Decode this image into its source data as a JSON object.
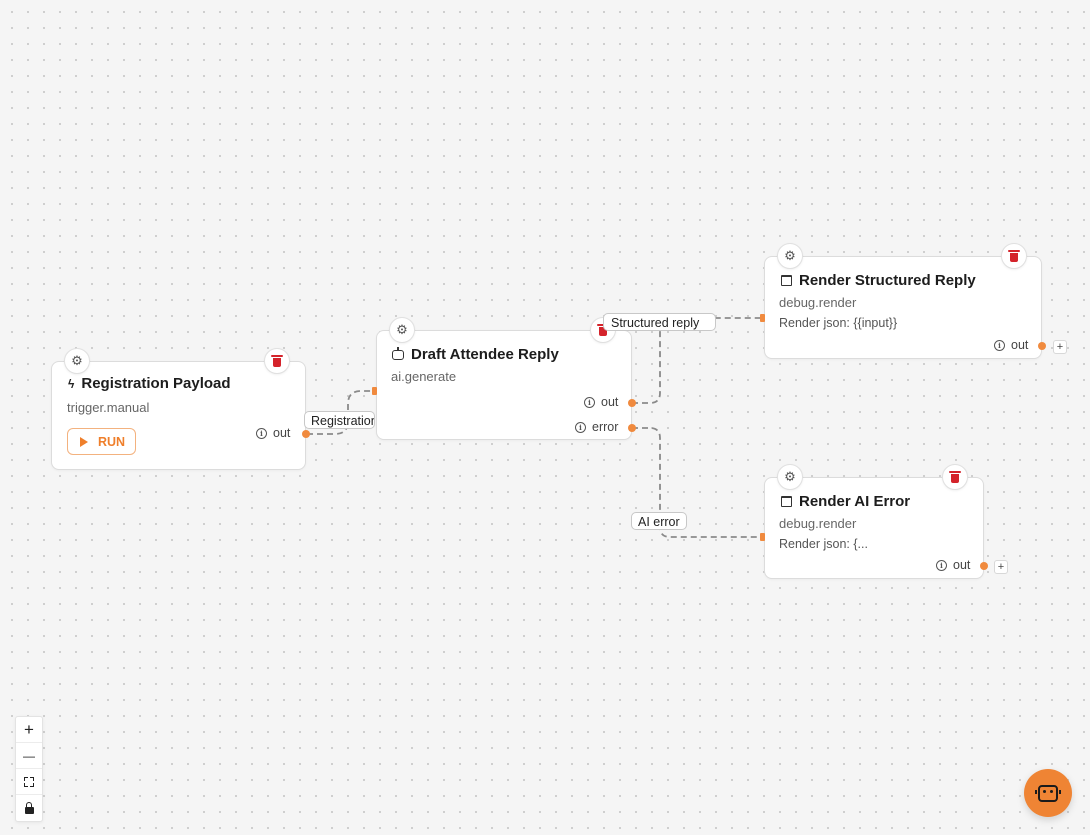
{
  "nodes": {
    "registration": {
      "title": "Registration Payload",
      "subtitle": "trigger.manual",
      "run_label": "RUN",
      "out_label": "out",
      "icon": "bolt-icon"
    },
    "draft": {
      "title": "Draft Attendee Reply",
      "subtitle": "ai.generate",
      "out_label": "out",
      "error_label": "error",
      "icon": "robot-icon"
    },
    "structured": {
      "title": "Render Structured Reply",
      "subtitle": "debug.render",
      "body": "Render json: {{input}}",
      "out_label": "out",
      "icon": "window-icon"
    },
    "ai_error": {
      "title": "Render AI Error",
      "subtitle": "debug.render",
      "body": "Render json: {...",
      "out_label": "out",
      "icon": "window-icon"
    }
  },
  "edges": {
    "registration_label": "Registration",
    "structured_label": "Structured reply",
    "ai_error_label": "AI error"
  },
  "controls": {
    "zoom_in": "+",
    "zoom_out": "—"
  },
  "colors": {
    "accent": "#ef8434",
    "delete": "#d4232b",
    "handle": "#f08a3e"
  }
}
